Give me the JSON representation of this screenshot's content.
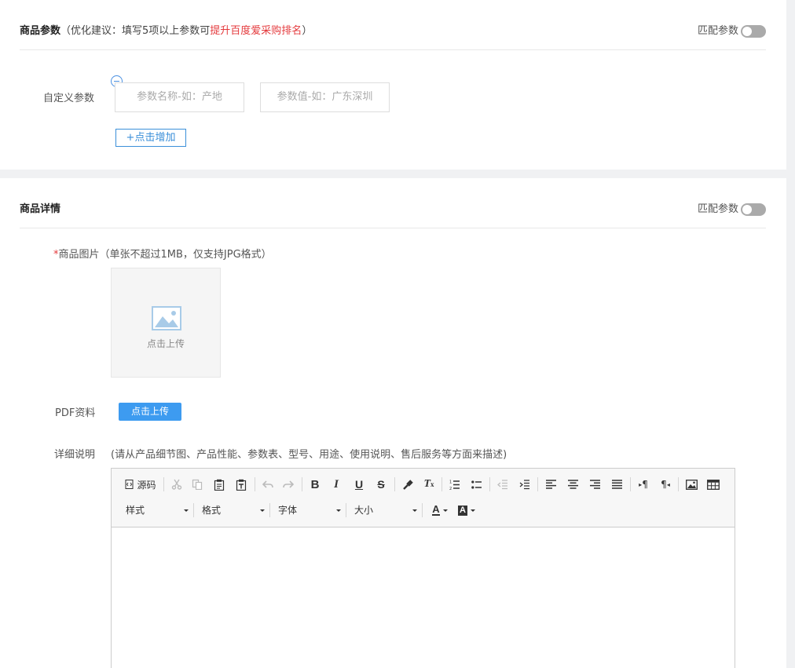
{
  "params_section": {
    "title": "商品参数",
    "tip_prefix": "（优化建议：填写5项以上参数可",
    "tip_highlight": "提升百度爱采购排名",
    "tip_suffix": "）",
    "match_label": "匹配参数",
    "match_enabled": false,
    "custom_label": "自定义参数",
    "name_placeholder": "参数名称-如：产地",
    "value_placeholder": "参数值-如：广东深圳",
    "add_label": "+点击增加"
  },
  "detail_section": {
    "title": "商品详情",
    "match_label": "匹配参数",
    "match_enabled": false,
    "image_required_mark": "*",
    "image_label": "商品图片（单张不超过1MB，仅支持JPG格式）",
    "image_upload_text": "点击上传",
    "pdf_label": "PDF资料",
    "pdf_button": "点击上传",
    "desc_label": "详细说明",
    "desc_hint": "(请从产品细节图、产品性能、参数表、型号、用途、使用说明、售后服务等方面来描述)"
  },
  "editor": {
    "source_label": "源码",
    "style_combo": "样式",
    "format_combo": "格式",
    "font_combo": "字体",
    "size_combo": "大小",
    "content": ""
  },
  "colors": {
    "accent_blue": "#3d9bf0",
    "highlight_red": "#e4393c",
    "toggle_off": "#aaaaaa"
  }
}
